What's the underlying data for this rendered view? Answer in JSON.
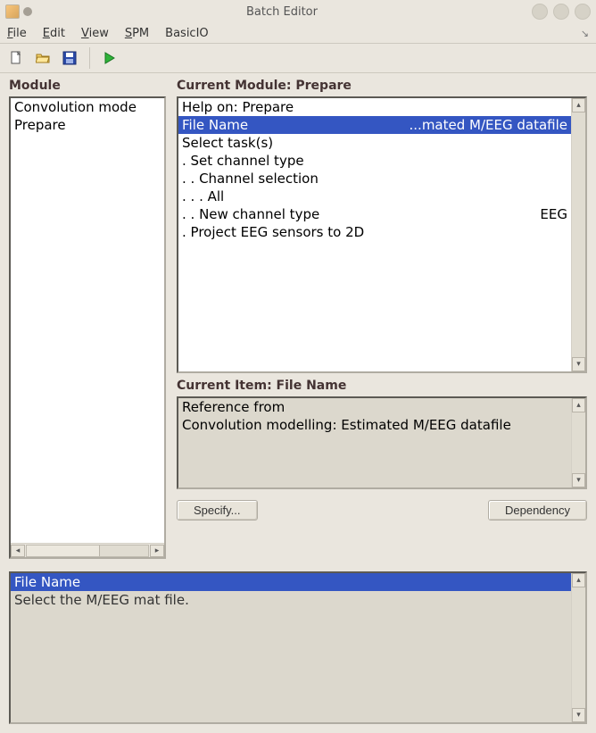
{
  "window": {
    "title": "Batch Editor"
  },
  "menubar": {
    "file": "File",
    "edit": "Edit",
    "view": "View",
    "spm": "SPM",
    "basicio": "BasicIO"
  },
  "module_list": {
    "label": "Module",
    "items": [
      {
        "text": "Convolution mode",
        "selected": false
      },
      {
        "text": "Prepare",
        "selected": false
      }
    ]
  },
  "current_module": {
    "label": "Current Module: Prepare",
    "rows": [
      {
        "left": "Help on: Prepare",
        "right": "",
        "selected": false
      },
      {
        "left": "File Name",
        "right": "...mated M/EEG datafile",
        "selected": true
      },
      {
        "left": "Select task(s)",
        "right": "",
        "selected": false
      },
      {
        "left": ". Set channel type",
        "right": "",
        "selected": false
      },
      {
        "left": ". . Channel selection",
        "right": "",
        "selected": false
      },
      {
        "left": ". . . All",
        "right": "",
        "selected": false
      },
      {
        "left": ". . New channel type",
        "right": "EEG",
        "selected": false
      },
      {
        "left": ". Project EEG sensors to 2D",
        "right": "",
        "selected": false
      }
    ]
  },
  "current_item": {
    "label": "Current Item: File Name",
    "rows": [
      "Reference from",
      "Convolution modelling: Estimated M/EEG datafile"
    ]
  },
  "buttons": {
    "specify": "Specify...",
    "dependency": "Dependency"
  },
  "help": {
    "title": "File Name",
    "body": "Select the M/EEG mat file."
  },
  "icons": {
    "new": "new-doc-icon",
    "open": "open-folder-icon",
    "save": "save-floppy-icon",
    "run": "run-play-icon"
  }
}
